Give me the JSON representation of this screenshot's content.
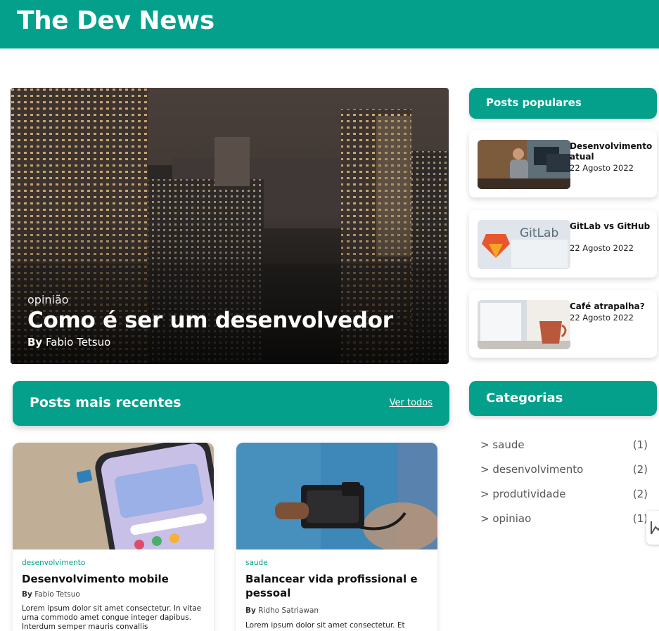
{
  "header": {
    "site_title": "The Dev News"
  },
  "featured": {
    "category": "opinião",
    "title": "Como é ser um desenvolvedor",
    "author_prefix": "By",
    "author": "Fabio Tetsuo"
  },
  "recent": {
    "heading": "Posts mais recentes",
    "see_all": "Ver todos",
    "posts": [
      {
        "category": "desenvolvimento",
        "title": "Desenvolvimento mobile",
        "author_prefix": "By",
        "author": "Fabio Tetsuo",
        "excerpt": "Lorem ipsum dolor sit amet consectetur. In vitae urna commodo amet congue integer dapibus. Interdum semper mauris convallis"
      },
      {
        "category": "saude",
        "title": "Balancear vida profissional e pessoal",
        "author_prefix": "By",
        "author": "Ridho Satriawan",
        "excerpt": "Lorem ipsum dolor sit amet consectetur. Et"
      }
    ]
  },
  "popular": {
    "heading": "Posts populares",
    "posts": [
      {
        "title": "Desenvolvimento atual",
        "date": "22 Agosto 2022"
      },
      {
        "title": "GitLab vs GitHub",
        "date": "22 Agosto 2022",
        "thumb_text": "GitLab"
      },
      {
        "title": "Café atrapalha?",
        "date": "22 Agosto 2022"
      }
    ]
  },
  "categories": {
    "heading": "Categorias",
    "items": [
      {
        "name": "> saude",
        "count": "(1)"
      },
      {
        "name": "> desenvolvimento",
        "count": "(2)"
      },
      {
        "name": "> produtividade",
        "count": "(2)"
      },
      {
        "name": "> opiniao",
        "count": "(1)"
      }
    ]
  },
  "colors": {
    "brand": "#04a08c",
    "text": "#111111",
    "muted": "#555555"
  }
}
